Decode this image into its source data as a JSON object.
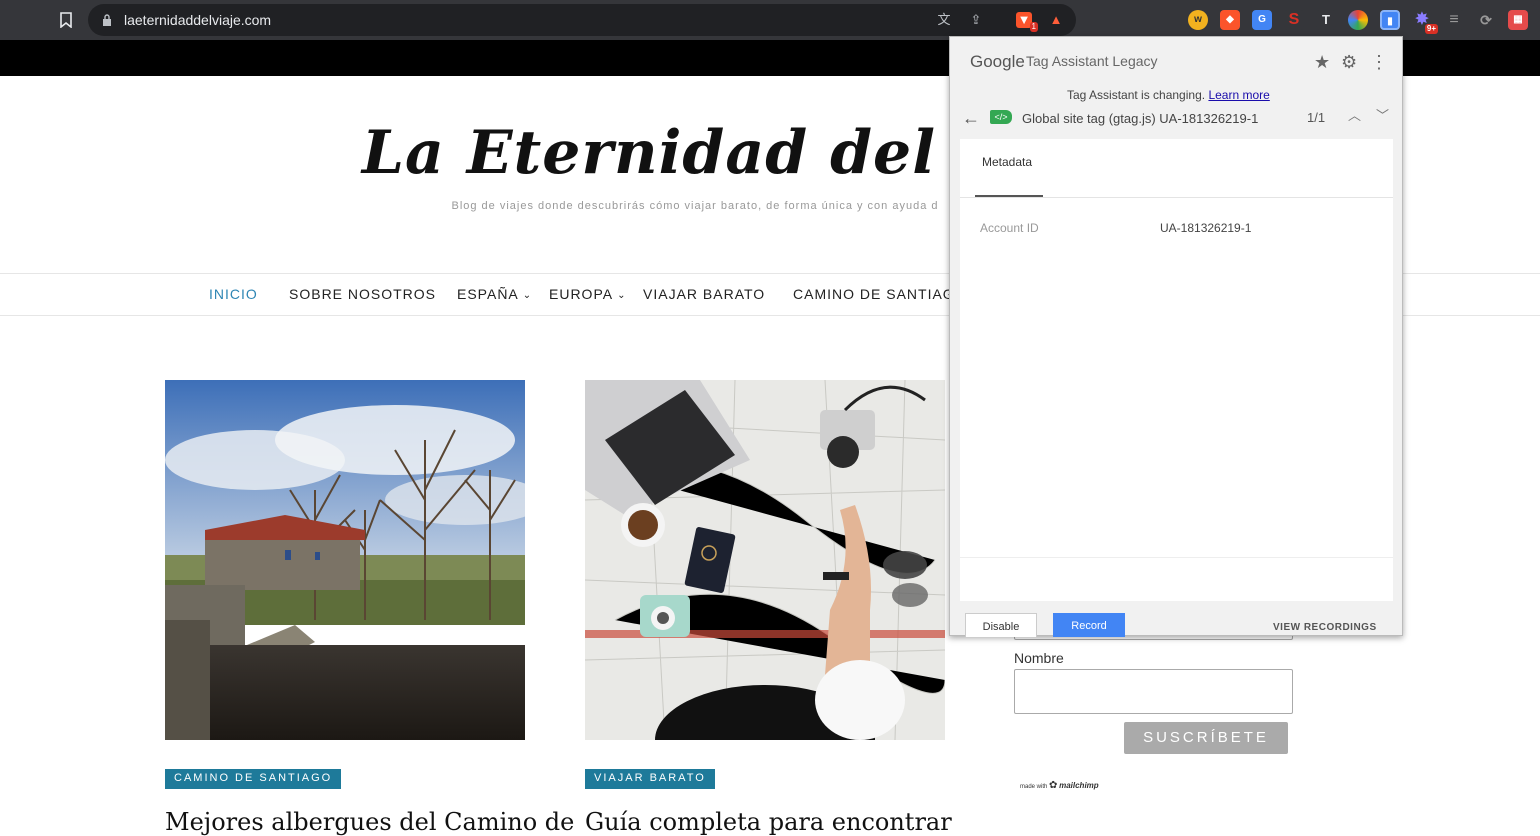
{
  "browser": {
    "url": "laeternidaddelviaje.com",
    "extensions": [
      {
        "name": "w-icon",
        "label": "w",
        "color": "#f2b21f"
      },
      {
        "name": "brave-shield-icon",
        "label": "",
        "color": "#ffffff"
      },
      {
        "name": "translate-icon",
        "label": "G",
        "color": "#4285f4"
      },
      {
        "name": "s-icon",
        "label": "S",
        "color": "#d93025"
      },
      {
        "name": "text-icon",
        "label": "T",
        "color": "#555555"
      },
      {
        "name": "circle-icon",
        "label": "",
        "color": "#8e44ad"
      },
      {
        "name": "tag-assistant-icon",
        "label": "1",
        "color": "#4285f4"
      },
      {
        "name": "spark-icon",
        "label": "",
        "color": "#6a5acd"
      },
      {
        "name": "stack-icon",
        "label": "",
        "color": "#777777"
      },
      {
        "name": "sync-icon",
        "label": "",
        "color": "#777777"
      },
      {
        "name": "puzzle-icon",
        "label": "",
        "color": "#e54b4b"
      }
    ],
    "brave_badge": "1",
    "spark_badge": "9+"
  },
  "site": {
    "title": "La Eternidad del Vi",
    "tagline": "Blog de viajes donde descubrirás cómo viajar barato, de forma única y con ayuda d"
  },
  "nav": {
    "items": [
      {
        "label": "INICIO",
        "active": true
      },
      {
        "label": "SOBRE NOSOTROS"
      },
      {
        "label": "ESPAÑA",
        "dropdown": true
      },
      {
        "label": "EUROPA",
        "dropdown": true
      },
      {
        "label": "VIAJAR BARATO"
      },
      {
        "label": "CAMINO DE SANTIAGO"
      }
    ]
  },
  "posts": [
    {
      "category": "CAMINO DE SANTIAGO",
      "title": "Mejores albergues del Camino de"
    },
    {
      "category": "VIAJAR BARATO",
      "title": "Guía completa para encontrar"
    }
  ],
  "form": {
    "name_label": "Nombre",
    "subscribe_label": "SUSCRÍBETE",
    "made_with": "made with",
    "mailchimp": "mailchimp"
  },
  "tag_assistant": {
    "google": "Google",
    "title": "Tag Assistant Legacy",
    "changing_text": "Tag Assistant is changing.",
    "learn_more": "Learn more",
    "tag_name": "Global site tag (gtag.js) UA-181326219-1",
    "count": "1/1",
    "tab": "Metadata",
    "account_id_label": "Account ID",
    "account_id_value": "UA-181326219-1",
    "disable": "Disable",
    "record": "Record",
    "view_recordings": "VIEW RECORDINGS",
    "colors": {
      "record": "#4285f4",
      "tag": "#34a853"
    }
  }
}
